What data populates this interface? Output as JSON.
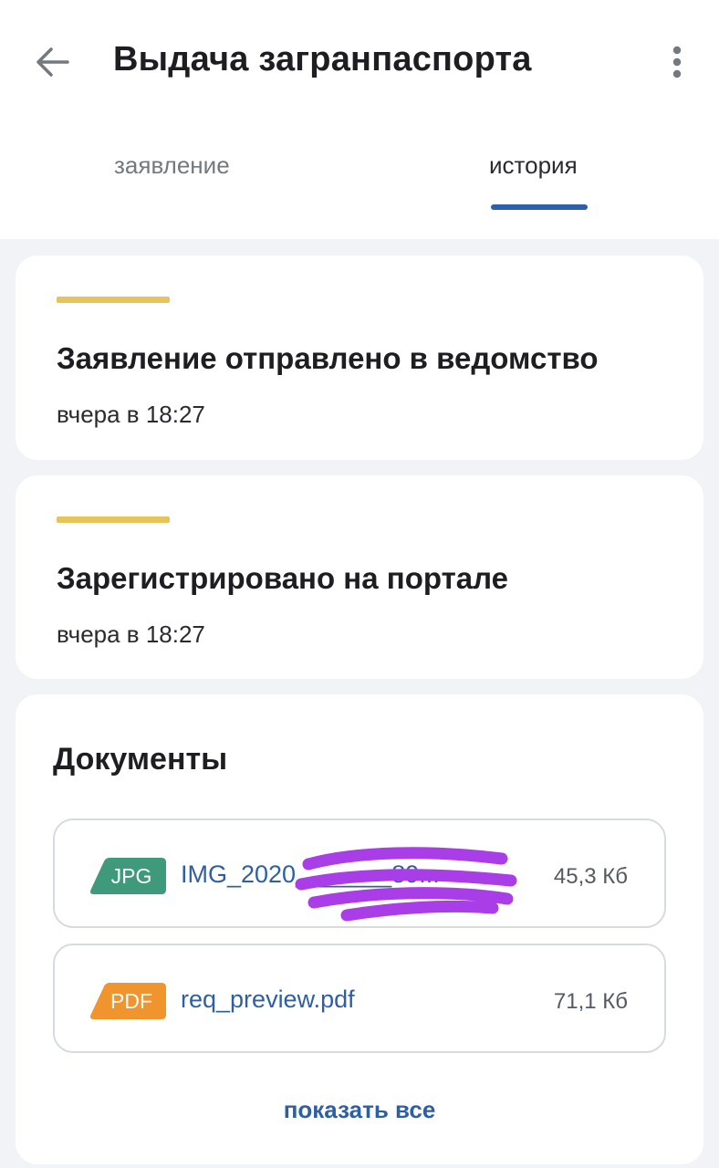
{
  "header": {
    "title": "Выдача загранпаспорта",
    "back_icon": "arrow-left-icon",
    "menu_icon": "more-vertical-icon"
  },
  "tabs": [
    {
      "label": "заявление",
      "active": false
    },
    {
      "label": "история",
      "active": true
    }
  ],
  "history": [
    {
      "title": "Заявление отправлено в ведомство",
      "time": "вчера в 18:27",
      "status_color": "#e8c35a"
    },
    {
      "title": "Зарегистрировано на портале",
      "time": "вчера в 18:27",
      "status_color": "#e8c35a"
    }
  ],
  "documents": {
    "title": "Документы",
    "items": [
      {
        "type": "JPG",
        "badge_color": "#3f9a7c",
        "name": "IMG_2020_______89...",
        "size": "45,3 Кб"
      },
      {
        "type": "PDF",
        "badge_color": "#f0942e",
        "name": "req_preview.pdf",
        "size": "71,1 Кб"
      }
    ],
    "show_all": "показать все"
  },
  "colors": {
    "accent": "#2c5fad",
    "link": "#2f5fa3",
    "status": "#e8c35a",
    "redaction": "#a93ee8"
  }
}
